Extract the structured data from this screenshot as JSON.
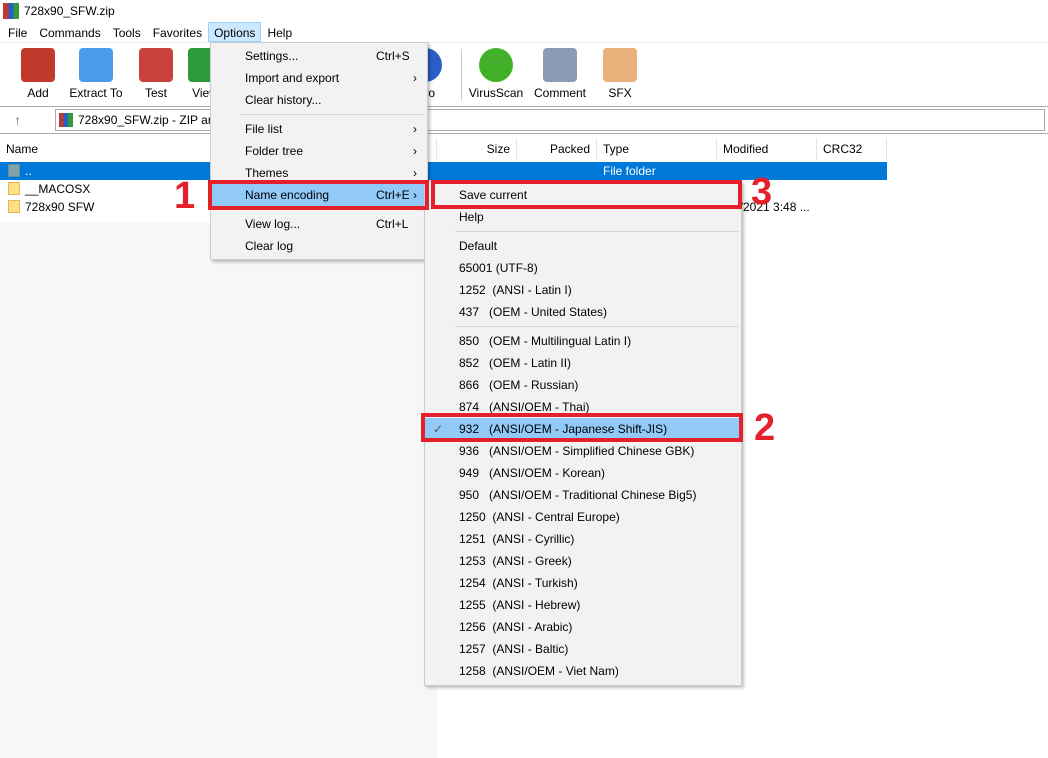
{
  "window": {
    "title": "728x90_SFW.zip"
  },
  "menubar": [
    "File",
    "Commands",
    "Tools",
    "Favorites",
    "Options",
    "Help"
  ],
  "toolbar": [
    {
      "label": "Add",
      "icon": "add-archive-icon",
      "color": "#c0392b"
    },
    {
      "label": "Extract To",
      "icon": "extract-folder-icon",
      "color": "#4a9be8"
    },
    {
      "label": "Test",
      "icon": "test-clipboard-icon",
      "color": "#c8413b"
    },
    {
      "label": "View",
      "icon": "view-book-icon",
      "color": "#2e9a3a"
    },
    {
      "label": "Info",
      "icon": "info-icon",
      "color": "#2a5fc7"
    },
    {
      "label": "VirusScan",
      "icon": "virus-scan-icon",
      "color": "#43b02a"
    },
    {
      "label": "Comment",
      "icon": "comment-icon",
      "color": "#8a9bb3"
    },
    {
      "label": "SFX",
      "icon": "sfx-box-icon",
      "color": "#e8b07a"
    }
  ],
  "address": {
    "text": "728x90_SFW.zip - ZIP archive"
  },
  "columns": [
    "Name",
    "Size",
    "Packed",
    "Type",
    "Modified",
    "CRC32"
  ],
  "rows": [
    {
      "name": "..",
      "type": "File folder",
      "modified": ""
    },
    {
      "name": "__MACOSX",
      "type": "",
      "modified": ""
    },
    {
      "name": "728x90 SFW",
      "type": "",
      "modified": "5/2021 3:48 ..."
    }
  ],
  "options_menu": [
    {
      "label": "Settings...",
      "shortcut": "Ctrl+S"
    },
    {
      "label": "Import and export",
      "submenu": true
    },
    {
      "label": "Clear history..."
    },
    {
      "sep": true
    },
    {
      "label": "File list",
      "submenu": true
    },
    {
      "label": "Folder tree",
      "submenu": true
    },
    {
      "label": "Themes",
      "submenu": true
    },
    {
      "label": "Name encoding",
      "shortcut": "Ctrl+E",
      "submenu": true,
      "highlighted": true
    },
    {
      "sep": true
    },
    {
      "label": "View log...",
      "shortcut": "Ctrl+L"
    },
    {
      "label": "Clear log"
    }
  ],
  "encoding_menu": [
    {
      "label": "Save current"
    },
    {
      "label": "Help"
    },
    {
      "sep": true
    },
    {
      "label": "Default"
    },
    {
      "label": "65001 (UTF-8)"
    },
    {
      "label": "1252  (ANSI - Latin I)"
    },
    {
      "label": "437   (OEM - United States)"
    },
    {
      "sep": true
    },
    {
      "label": "850   (OEM - Multilingual Latin I)"
    },
    {
      "label": "852   (OEM - Latin II)"
    },
    {
      "label": "866   (OEM - Russian)"
    },
    {
      "label": "874   (ANSI/OEM - Thai)"
    },
    {
      "label": "932   (ANSI/OEM - Japanese Shift-JIS)",
      "checked": true,
      "highlighted": true
    },
    {
      "label": "936   (ANSI/OEM - Simplified Chinese GBK)"
    },
    {
      "label": "949   (ANSI/OEM - Korean)"
    },
    {
      "label": "950   (ANSI/OEM - Traditional Chinese Big5)"
    },
    {
      "label": "1250  (ANSI - Central Europe)"
    },
    {
      "label": "1251  (ANSI - Cyrillic)"
    },
    {
      "label": "1253  (ANSI - Greek)"
    },
    {
      "label": "1254  (ANSI - Turkish)"
    },
    {
      "label": "1255  (ANSI - Hebrew)"
    },
    {
      "label": "1256  (ANSI - Arabic)"
    },
    {
      "label": "1257  (ANSI - Baltic)"
    },
    {
      "label": "1258  (ANSI/OEM - Viet Nam)"
    }
  ],
  "annotations": {
    "step1": "1",
    "step2": "2",
    "step3": "3",
    "box_color": "#e5202a"
  },
  "colors": {
    "selection": "#0078d7",
    "menu_highlight": "#91c9f7"
  }
}
